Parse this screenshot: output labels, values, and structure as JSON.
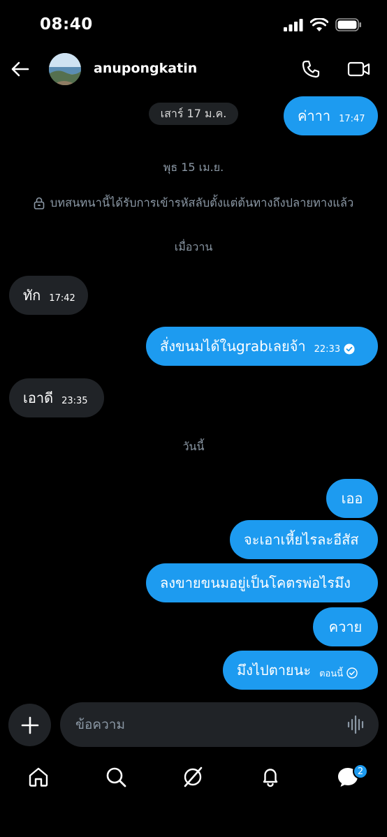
{
  "status_bar": {
    "time": "08:40"
  },
  "header": {
    "username": "anupongkatin"
  },
  "chat": {
    "date_pill": "เสาร์ 17 ม.ค.",
    "separators": {
      "wed": "พุธ 15 เม.ย.",
      "yesterday": "เมื่อวาน",
      "today": "วันนี้"
    },
    "encryption_note": "บทสนทนานี้ได้รับการเข้ารหัสลับตั้งแต่ต้นทางถึงปลายทางแล้ว",
    "messages": [
      {
        "text": "ค่าาา",
        "time": "17:47",
        "dir": "out"
      },
      {
        "text": "ทัก",
        "time": "17:42",
        "dir": "in"
      },
      {
        "text": "สั่งขนมได้ในgrabเลยจ้า",
        "time": "22:33",
        "dir": "out"
      },
      {
        "text": "เอาดี",
        "time": "23:35",
        "dir": "in"
      },
      {
        "text": "เออ",
        "dir": "out"
      },
      {
        "text": "จะเอาเหี้ยไรละอีสัส",
        "dir": "out"
      },
      {
        "text": "ลงขายขนมอยู่เป็นโคตรพ่อไรมึง",
        "dir": "out"
      },
      {
        "text": "ควาย",
        "dir": "out"
      },
      {
        "text": "มึงไปตายนะ",
        "time": "ตอนนี้",
        "dir": "out"
      }
    ]
  },
  "composer": {
    "placeholder": "ข้อความ"
  },
  "nav": {
    "messages_badge": "2"
  },
  "colors": {
    "accent": "#1d9bf0",
    "incoming": "#202327",
    "background": "#000000"
  }
}
